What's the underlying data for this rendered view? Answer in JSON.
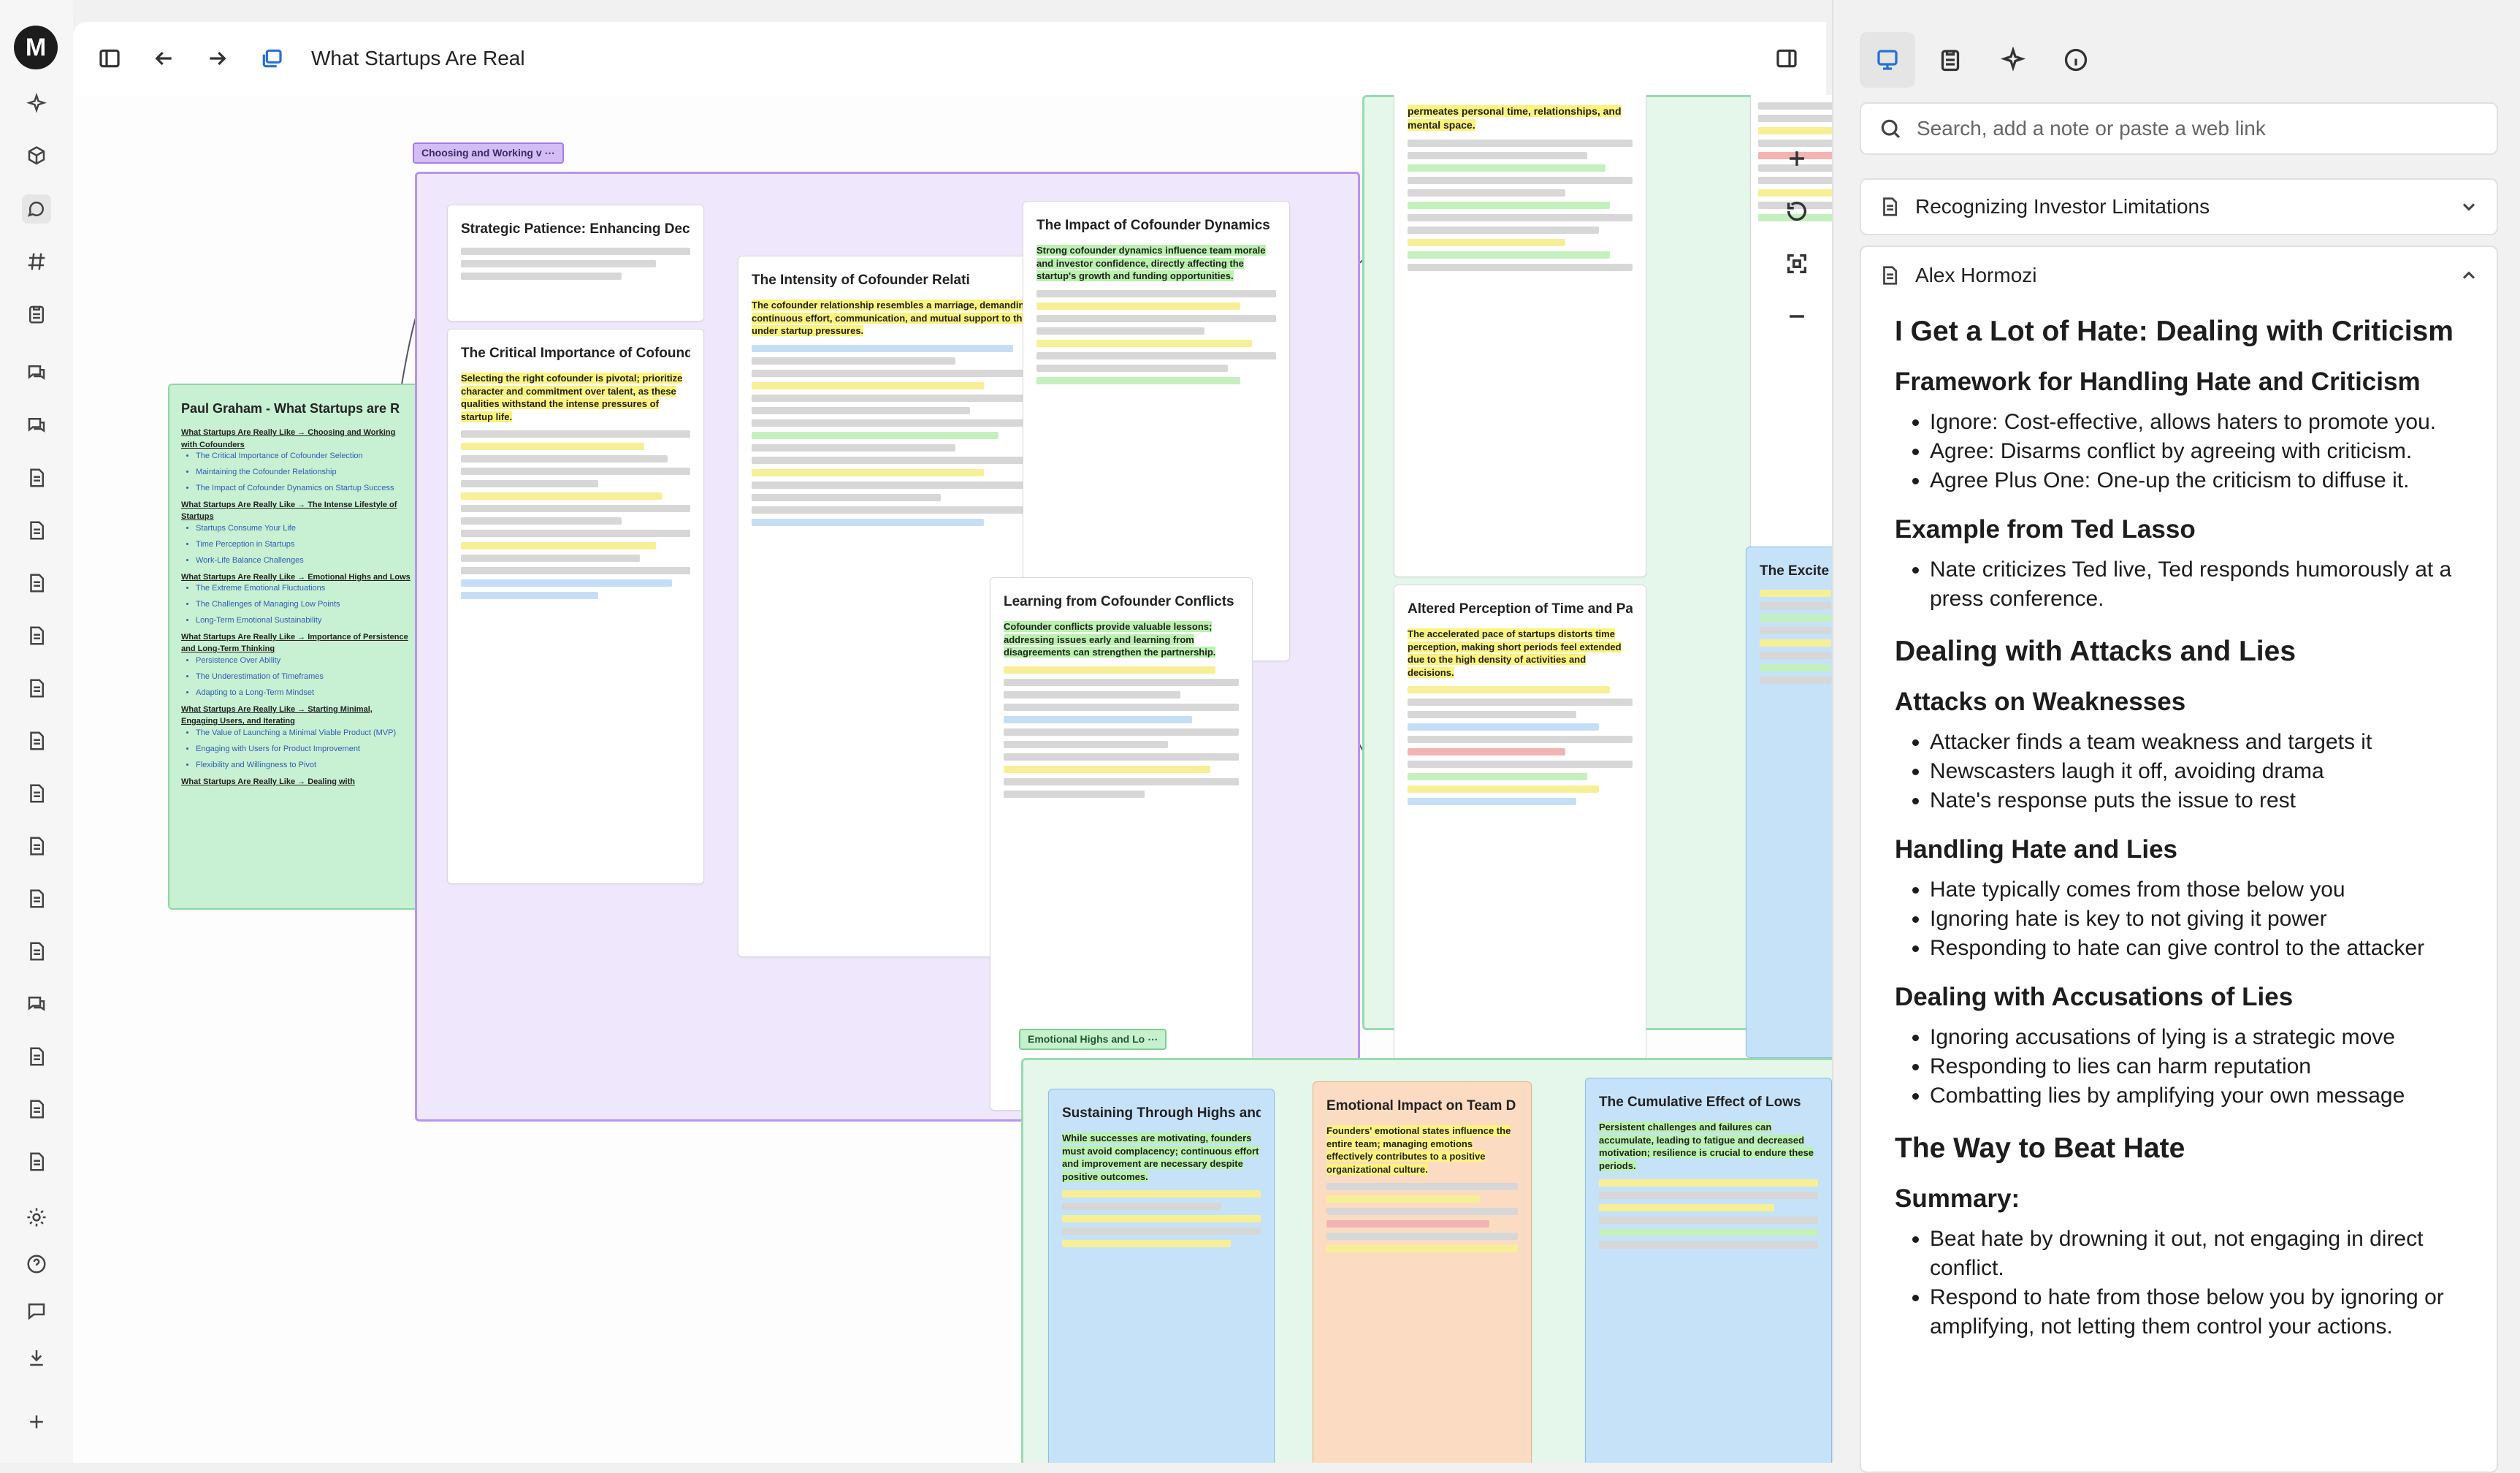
{
  "app": {
    "logo_letter": "M"
  },
  "toolbar": {
    "title": "What Startups Are Real"
  },
  "rail": {
    "icons": [
      "sparkle-icon",
      "cube-icon",
      "chat-alt-icon",
      "hash-icon",
      "clipboard-icon",
      "chat-icon",
      "chat-icon",
      "document-icon",
      "document-icon",
      "document-icon",
      "document-icon",
      "document-icon",
      "document-icon",
      "document-icon",
      "document-icon",
      "document-icon",
      "document-icon",
      "chat-icon",
      "document-icon",
      "document-icon",
      "document-icon",
      "gear-icon",
      "help-icon",
      "message-icon",
      "download-icon",
      "plus-icon"
    ]
  },
  "canvas": {
    "groups": {
      "purple_tag": "Choosing and Working v",
      "emotional_tag": "Emotional Highs and Lo"
    },
    "overview": {
      "title": "Paul Graham - What Startups are R",
      "sections": [
        {
          "heading": "What Startups Are Really Like → Choosing and Working with Cofounders",
          "links": [
            "The Critical Importance of Cofounder Selection",
            "Maintaining the Cofounder Relationship",
            "The Impact of Cofounder Dynamics on Startup Success"
          ]
        },
        {
          "heading": "What Startups Are Really Like → The Intense Lifestyle of Startups",
          "links": [
            "Startups Consume Your Life",
            "Time Perception in Startups",
            "Work-Life Balance Challenges"
          ]
        },
        {
          "heading": "What Startups Are Really Like → Emotional Highs and Lows",
          "links": [
            "The Extreme Emotional Fluctuations",
            "The Challenges of Managing Low Points",
            "Long-Term Emotional Sustainability"
          ]
        },
        {
          "heading": "What Startups Are Really Like → Importance of Persistence and Long-Term Thinking",
          "links": [
            "Persistence Over Ability",
            "The Underestimation of Timeframes",
            "Adapting to a Long-Term Mindset"
          ]
        },
        {
          "heading": "What Startups Are Really Like → Starting Minimal, Engaging Users, and Iterating",
          "links": [
            "The Value of Launching a Minimal Viable Product (MVP)",
            "Engaging with Users for Product Improvement",
            "Flexibility and Willingness to Pivot"
          ]
        },
        {
          "heading": "What Startups Are Really Like → Dealing with",
          "links": []
        }
      ]
    },
    "cards": {
      "strategic": {
        "title": "Strategic Patience: Enhancing Deci"
      },
      "critical": {
        "title": "The Critical Importance of Cofound",
        "lead": "Selecting the right cofounder is pivotal; prioritize character and commitment over talent, as these qualities withstand the intense pressures of startup life."
      },
      "intensity": {
        "title": "The Intensity of Cofounder Relati",
        "lead": "The cofounder relationship resembles a marriage, demanding continuous effort, communication, and mutual support to thrive under startup pressures."
      },
      "impact": {
        "title": "The Impact of Cofounder Dynamics",
        "lead": "Strong cofounder dynamics influence team morale and investor confidence, directly affecting the startup's growth and funding opportunities."
      },
      "conflicts": {
        "title": "Learning from Cofounder Conflicts",
        "lead": "Cofounder conflicts provide valuable lessons; addressing issues early and learning from disagreements can strengthen the partnership."
      },
      "permeates": {
        "title": "permeates personal time, relationships, and mental space."
      },
      "altered": {
        "title": "Altered Perception of Time and Pa",
        "lead": "The accelerated pace of startups distorts time perception, making short periods feel extended due to the high density of activities and decisions."
      },
      "excite": {
        "title": "The Excite"
      },
      "sustaining": {
        "title": "Sustaining Through Highs and",
        "lead": "While successes are motivating, founders must avoid complacency; continuous effort and improvement are necessary despite positive outcomes."
      },
      "emotional": {
        "title": "Emotional Impact on Team D",
        "lead": "Founders' emotional states influence the entire team; managing emotions effectively contributes to a positive organizational culture."
      },
      "cumulative": {
        "title": "The Cumulative Effect of Lows",
        "lead": "Persistent challenges and failures can accumulate, leading to fatigue and decreased motivation; resilience is crucial to endure these periods."
      }
    }
  },
  "panel": {
    "search": {
      "placeholder": "Search, add a note or paste a web link"
    },
    "notes": [
      {
        "title": "Recognizing Investor Limitations"
      },
      {
        "title": "Alex Hormozi"
      }
    ],
    "content": {
      "h1": "I Get a Lot of Hate: Dealing with Criticism",
      "s1_title": "Framework for Handling Hate and Criticism",
      "s1_items": [
        "Ignore: Cost-effective, allows haters to promote you.",
        "Agree: Disarms conflict by agreeing with criticism.",
        "Agree Plus One: One-up the criticism to diffuse it."
      ],
      "s2_title": "Example from Ted Lasso",
      "s2_items": [
        "Nate criticizes Ted live, Ted responds humorously at a press conference."
      ],
      "h2b": "Dealing with Attacks and Lies",
      "s3_title": "Attacks on Weaknesses",
      "s3_items": [
        "Attacker finds a team weakness and targets it",
        "Newscasters laugh it off, avoiding drama",
        "Nate's response puts the issue to rest"
      ],
      "s4_title": "Handling Hate and Lies",
      "s4_items": [
        "Hate typically comes from those below you",
        "Ignoring hate is key to not giving it power",
        "Responding to hate can give control to the attacker"
      ],
      "s5_title": "Dealing with Accusations of Lies",
      "s5_items": [
        "Ignoring accusations of lying is a strategic move",
        "Responding to lies can harm reputation",
        "Combatting lies by amplifying your own message"
      ],
      "h2c": "The Way to Beat Hate",
      "s6_title": "Summary:",
      "s6_items": [
        "Beat hate by drowning it out, not engaging in direct conflict.",
        "Respond to hate from those below you by ignoring or amplifying, not letting them control your actions."
      ]
    }
  }
}
